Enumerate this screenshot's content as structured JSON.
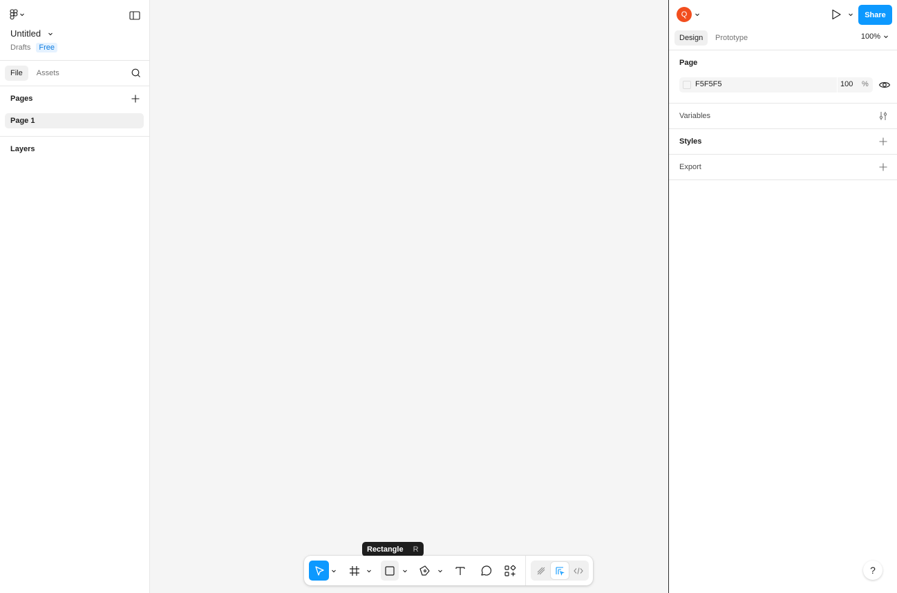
{
  "left_panel": {
    "file_title": "Untitled",
    "drafts_label": "Drafts",
    "plan_badge": "Free",
    "tabs": [
      "File",
      "Assets"
    ],
    "pages_header": "Pages",
    "pages": [
      "Page 1"
    ],
    "layers_header": "Layers"
  },
  "toolbar": {
    "tooltip_label": "Rectangle",
    "tooltip_shortcut": "R",
    "tools": [
      "move-icon",
      "frame-icon",
      "rectangle-icon",
      "pen-icon",
      "text-icon",
      "comment-icon",
      "actions-icon"
    ],
    "modes": [
      "draw-mode-icon",
      "design-mode-icon",
      "dev-mode-icon"
    ],
    "active_tool": "move",
    "active_mode": "design"
  },
  "right_panel": {
    "avatar_initial": "Q",
    "share_label": "Share",
    "tabs": [
      "Design",
      "Prototype"
    ],
    "zoom": "100%",
    "page_section": {
      "title": "Page",
      "color_hex": "F5F5F5",
      "opacity": "100",
      "opacity_unit": "%"
    },
    "variables_label": "Variables",
    "styles_label": "Styles",
    "export_label": "Export",
    "help_label": "?"
  },
  "colors": {
    "accent": "#0d99ff",
    "avatar": "#f24e1e",
    "canvas": "#f5f5f5",
    "badge_text": "#0d7ce0"
  }
}
